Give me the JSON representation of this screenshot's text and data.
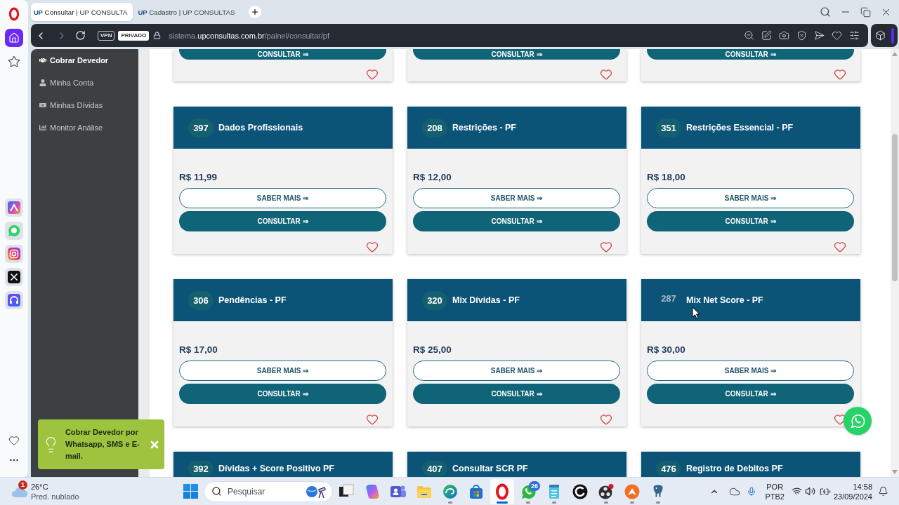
{
  "browser": {
    "tabs": [
      {
        "favicon": "UP",
        "title": "Consultar | UP CONSULTA",
        "selected": true
      },
      {
        "favicon": "UP",
        "title": "Cadastro | UP CONSULTAS",
        "selected": false
      }
    ],
    "address_bar": {
      "back_disabled": false,
      "forward_disabled": true,
      "vpn": "VPN",
      "private": "PRIVADO",
      "url": "sistema.**upconsultas.com.br**/painel/consultar/pf"
    }
  },
  "sidebar": {
    "items": [
      {
        "label": "Cobrar Devedor",
        "selected": true
      },
      {
        "label": "Minha Conta",
        "selected": false
      },
      {
        "label": "Minhas Dívidas",
        "selected": false
      },
      {
        "label": "Monitor Análise",
        "selected": false
      }
    ]
  },
  "card_rows": [
    {
      "kind": "cut_top",
      "cards": [
        {
          "action": "CONSULTAR ⇒",
          "favorite": false
        },
        {
          "action": "CONSULTAR ⇒",
          "favorite": false
        },
        {
          "action": "CONSULTAR ⇒",
          "favorite": false
        }
      ]
    },
    {
      "kind": "full",
      "cards": [
        {
          "number": "397",
          "title": "Dados Profissionais",
          "hovered": false,
          "price": "R$ 11,99",
          "info": "SABER MAIS ⇒",
          "action": "CONSULTAR ⇒",
          "favorite": false
        },
        {
          "number": "208",
          "title": "Restrições - PF",
          "hovered": false,
          "price": "R$ 12,00",
          "info": "SABER MAIS ⇒",
          "action": "CONSULTAR ⇒",
          "favorite": false
        },
        {
          "number": "351",
          "title": "Restrições Essencial - PF",
          "hovered": false,
          "price": "R$ 18,00",
          "info": "SABER MAIS ⇒",
          "action": "CONSULTAR ⇒",
          "favorite": false
        }
      ]
    },
    {
      "kind": "full",
      "cards": [
        {
          "number": "306",
          "title": "Pendências - PF",
          "hovered": false,
          "price": "R$ 17,00",
          "info": "SABER MAIS ⇒",
          "action": "CONSULTAR ⇒",
          "favorite": false
        },
        {
          "number": "320",
          "title": "Mix Dívidas - PF",
          "hovered": false,
          "price": "R$ 25,00",
          "info": "SABER MAIS ⇒",
          "action": "CONSULTAR ⇒",
          "favorite": false
        },
        {
          "number": "287",
          "title": "Mix Net Score - PF",
          "hovered": true,
          "price": "R$ 30,00",
          "info": "SABER MAIS ⇒",
          "action": "CONSULTAR ⇒",
          "favorite": false
        }
      ]
    },
    {
      "kind": "cut_bottom",
      "cards": [
        {
          "number": "392",
          "title": "Dívidas + Score Positivo PF",
          "hovered": false
        },
        {
          "number": "407",
          "title": "Consultar SCR PF",
          "hovered": false
        },
        {
          "number": "476",
          "title": "Registro de Debitos PF",
          "hovered": false
        }
      ]
    }
  ],
  "toast": {
    "text": "Cobrar Devedor por Whatsapp, SMS e E-mail."
  },
  "taskbar": {
    "weather": {
      "badge": "1",
      "temperature": "26°C",
      "condition": "Pred. nublado"
    },
    "search_placeholder": "Pesquisar",
    "apps": [
      {
        "running": false,
        "selected": false
      },
      {
        "running": false,
        "selected": false
      },
      {
        "running": false,
        "selected": false
      },
      {
        "running": false,
        "selected": false
      },
      {
        "running": true,
        "selected": false
      },
      {
        "running": false,
        "selected": false
      },
      {
        "running": true,
        "selected": true
      },
      {
        "running": true,
        "selected": false,
        "badge": "26"
      },
      {
        "running": true,
        "selected": false
      },
      {
        "running": false,
        "selected": false
      },
      {
        "running": true,
        "selected": false
      },
      {
        "running": true,
        "selected": false
      },
      {
        "running": true,
        "selected": false
      }
    ],
    "language": "POR",
    "layout": "PTB2",
    "time": "14:58",
    "date": "23/09/2024"
  }
}
